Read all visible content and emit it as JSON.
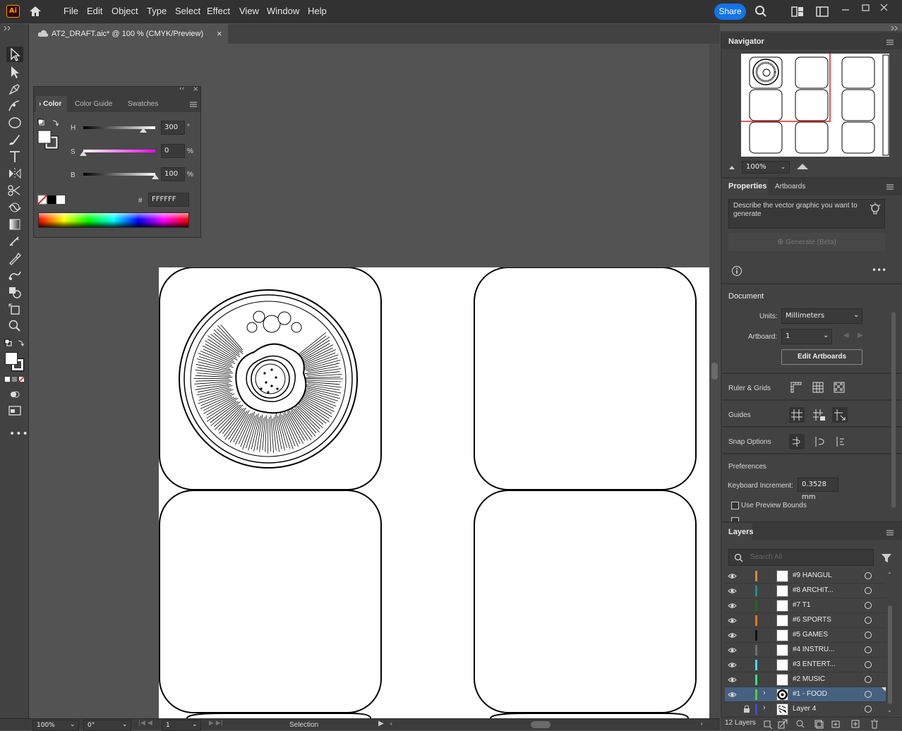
{
  "app": {
    "logo": "Ai"
  },
  "menu": [
    "File",
    "Edit",
    "Object",
    "Type",
    "Select",
    "Effect",
    "View",
    "Window",
    "Help"
  ],
  "share_label": "Share",
  "document_tab": {
    "title": "AT2_DRAFT.aic* @ 100 % (CMYK/Preview)",
    "close": "×"
  },
  "color_panel": {
    "tabs": [
      "Color",
      "Color Guide",
      "Swatches"
    ],
    "h_label": "H",
    "h_value": "300",
    "h_unit": "°",
    "s_label": "S",
    "s_value": "0",
    "s_unit": "%",
    "b_label": "B",
    "b_value": "100",
    "b_unit": "%",
    "hex_prefix": "#",
    "hex_value": "FFFFFF"
  },
  "navigator": {
    "title": "Navigator",
    "zoom": "100%"
  },
  "properties": {
    "tabs": [
      "Properties",
      "Artboards"
    ],
    "prompt_placeholder": "Describe the vector graphic you want to generate",
    "generate_label": "Generate (Beta)",
    "document_label": "Document",
    "units_label": "Units:",
    "units_value": "Millimeters",
    "artboard_label": "Artboard:",
    "artboard_value": "1",
    "edit_artboards": "Edit Artboards",
    "ruler_grids": "Ruler & Grids",
    "guides": "Guides",
    "snap_options": "Snap Options",
    "preferences": "Preferences",
    "keyboard_increment_label": "Keyboard Increment:",
    "keyboard_increment_value": "0.3528 mm",
    "use_preview_bounds": "Use Preview Bounds",
    "cut_off_text": "Scale Co..."
  },
  "layers": {
    "title": "Layers",
    "search_placeholder": "Search All",
    "items": [
      {
        "name": "#9 HANGUL",
        "color": "#d98a36"
      },
      {
        "name": "#8 ARCHIT...",
        "color": "#1f8f8f"
      },
      {
        "name": "#7 T1",
        "color": "#1e6b1e"
      },
      {
        "name": "#6 SPORTS",
        "color": "#e8761b"
      },
      {
        "name": "#5 GAMES",
        "color": "#111111"
      },
      {
        "name": "#4 INSTRU...",
        "color": "#6f6f6f"
      },
      {
        "name": "#3 ENTERT...",
        "color": "#3fe0e6"
      },
      {
        "name": "#2 MUSIC",
        "color": "#37e27a"
      },
      {
        "name": "#1 - FOOD",
        "color": "#4ccf3f"
      },
      {
        "name": "Layer 4",
        "color": "#3e4bd6"
      }
    ],
    "count": "12 Layers"
  },
  "status_bar": {
    "zoom": "100%",
    "rotation": "0°",
    "artboard": "1",
    "tool": "Selection"
  }
}
